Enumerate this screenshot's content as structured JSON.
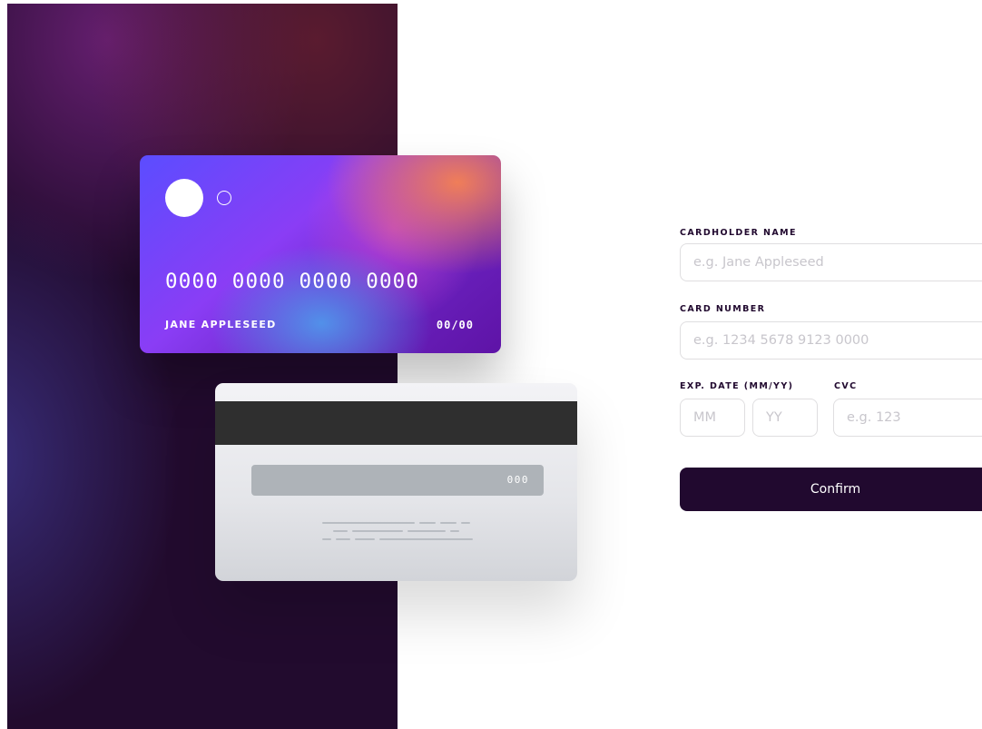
{
  "card_front": {
    "number": "0000 0000 0000 0000",
    "holder": "JANE APPLESEED",
    "expiry": "00/00"
  },
  "card_back": {
    "cvc": "000"
  },
  "form": {
    "name": {
      "label": "CARDHOLDER NAME",
      "placeholder": "e.g. Jane Appleseed"
    },
    "number": {
      "label": "CARD NUMBER",
      "placeholder": "e.g. 1234 5678 9123 0000"
    },
    "exp": {
      "label": "EXP. DATE (MM/YY)",
      "mm_placeholder": "MM",
      "yy_placeholder": "YY"
    },
    "cvc": {
      "label": "CVC",
      "placeholder": "e.g. 123"
    },
    "confirm_label": "Confirm"
  },
  "colors": {
    "deep_violet": "#21092f",
    "input_border": "#dfdee0",
    "placeholder": "#c8c6cc"
  }
}
